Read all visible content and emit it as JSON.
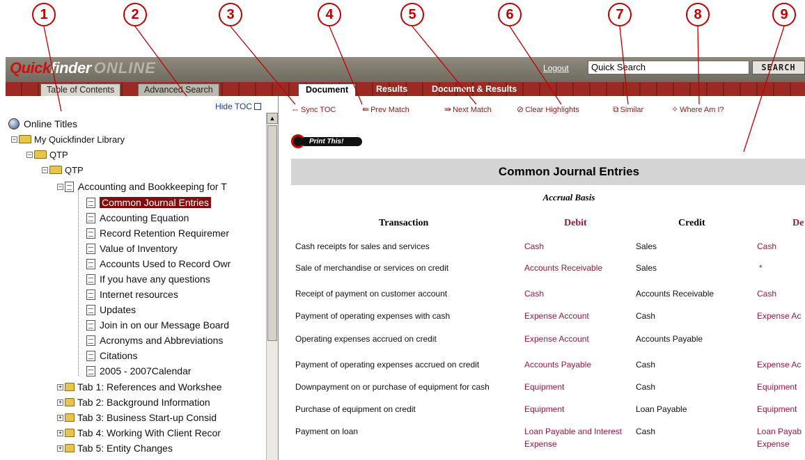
{
  "callouts": [
    "1",
    "2",
    "3",
    "4",
    "5",
    "6",
    "7",
    "8",
    "9"
  ],
  "header": {
    "logo_q": "Quick",
    "logo_finder": "finder",
    "logo_online": "ONLINE",
    "logout": "Logout",
    "search_value": "Quick Search",
    "search_button": "SEARCH"
  },
  "left_tabs": {
    "toc": "Table of Contents",
    "advanced": "Advanced Search"
  },
  "doc_tabs": {
    "document": "Document",
    "results": "Results",
    "doc_results": "Document & Results"
  },
  "toc": {
    "hide_label": "Hide TOC",
    "root": "Online Titles",
    "library": "My Quickfinder Library",
    "qtp1": "QTP",
    "qtp2": "QTP",
    "section": "Accounting and Bookkeeping for T",
    "items": [
      "Common Journal Entries",
      "Accounting Equation",
      "Record Retention Requiremer",
      "Value of Inventory",
      "Accounts Used to Record Owr",
      "If you have any questions",
      "Internet resources",
      "Updates",
      "Join in on our Message Board",
      "Acronyms and Abbreviations",
      "Citations",
      "2005 - 2007Calendar"
    ],
    "tabs": [
      "Tab 1: References and Workshee",
      "Tab 2: Background Information",
      "Tab 3: Business Start-up Consid",
      "Tab 4: Working With Client Recor",
      "Tab 5: Entity Changes"
    ]
  },
  "toolbar": {
    "sync": "Sync TOC",
    "prev": "Prev Match",
    "next": "Next Match",
    "clear": "Clear Highlights",
    "similar": "Similar",
    "where": "Where Am I?"
  },
  "print_label": "Print This!",
  "document": {
    "title": "Common Journal Entries",
    "subtitle": "Accrual Basis",
    "headers": {
      "transaction": "Transaction",
      "debit": "Debit",
      "credit": "Credit",
      "debit2": "De"
    },
    "rows": [
      {
        "t": "Cash receipts for sales and services",
        "d": "Cash",
        "c": "Sales",
        "d2": "Cash"
      },
      {
        "t": "Sale of merchandise or services on credit",
        "d": "Accounts Receivable",
        "c": "Sales",
        "d2": "*"
      },
      {
        "t": "Receipt of payment on customer account",
        "d": "Cash",
        "c": "Accounts Receivable",
        "d2": "Cash"
      },
      {
        "t": "Payment of operating expenses with cash",
        "d": "Expense Account",
        "c": "Cash",
        "d2": "Expense Ac"
      },
      {
        "t": "Operating expenses accrued on credit",
        "d": "Expense Account",
        "c": "Accounts Payable",
        "d2": ""
      },
      {
        "t": "Payment of operating expenses accrued on credit",
        "d": "Accounts Payable",
        "c": "Cash",
        "d2": "Expense Ac"
      },
      {
        "t": "Downpayment on or purchase of equipment for cash",
        "d": "Equipment",
        "c": "Cash",
        "d2": "Equipment"
      },
      {
        "t": "Purchase of equipment on credit",
        "d": "Equipment",
        "c": "Loan Payable",
        "d2": "Equipment"
      },
      {
        "t": "Payment on loan",
        "d": "Loan Payable and Interest",
        "d_line2": "Expense",
        "c": "Cash",
        "d2": "Loan Payab",
        "d2_line2": "Expense"
      }
    ]
  },
  "colors": {
    "brand_red": "#9c1747",
    "header_bg": "#7d786c",
    "tab_strip": "#8f251e",
    "selection": "#7f0e10"
  }
}
